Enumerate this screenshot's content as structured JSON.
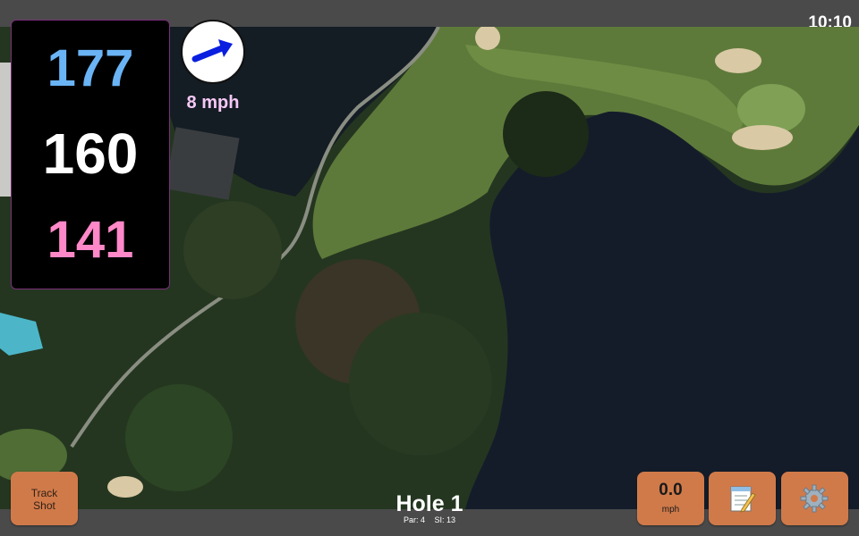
{
  "status": {
    "time": "10:10"
  },
  "distances": {
    "back": "177",
    "middle": "160",
    "front": "141"
  },
  "wind": {
    "speed_label": "8 mph",
    "direction_icon": "arrow-icon"
  },
  "hole": {
    "title": "Hole 1",
    "par": "Par: 4",
    "si": "SI: 13"
  },
  "buttons": {
    "track_shot": [
      "Track",
      "Shot"
    ],
    "speed_value": "0.0",
    "speed_unit": "mph",
    "notes_icon": "notepad-icon",
    "settings_icon": "gear-icon"
  },
  "colors": {
    "back_distance": "#6ab4f5",
    "middle_distance": "#ffffff",
    "front_distance": "#ff88c8",
    "button": "#d07a4a",
    "wind_label": "#f5c8f5"
  }
}
